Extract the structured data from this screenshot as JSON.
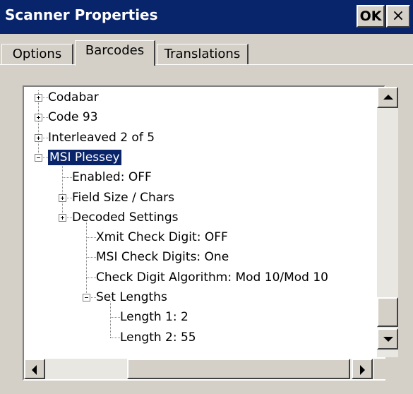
{
  "window": {
    "title": "Scanner Properties",
    "ok_label": "OK",
    "close_label": "×"
  },
  "tabs": [
    {
      "label": "Options"
    },
    {
      "label": "Barcodes"
    },
    {
      "label": "Translations"
    }
  ],
  "tree": {
    "nodes": [
      {
        "label": "Codabar",
        "level": 0,
        "expander": "plus"
      },
      {
        "label": "Code 93",
        "level": 0,
        "expander": "plus"
      },
      {
        "label": "Interleaved 2 of 5",
        "level": 0,
        "expander": "plus"
      },
      {
        "label": "MSI Plessey",
        "level": 0,
        "expander": "minus",
        "selected": true
      },
      {
        "label": "Enabled: OFF",
        "level": 1,
        "expander": "none"
      },
      {
        "label": "Field Size / Chars",
        "level": 1,
        "expander": "plus"
      },
      {
        "label": "Decoded Settings",
        "level": 1,
        "expander": "plus"
      },
      {
        "label": "Xmit Check Digit: OFF",
        "level": 2,
        "expander": "none"
      },
      {
        "label": "MSI Check Digits: One",
        "level": 2,
        "expander": "none"
      },
      {
        "label": "Check Digit Algorithm: Mod 10/Mod 10",
        "level": 2,
        "expander": "none"
      },
      {
        "label": "Set Lengths",
        "level": 2,
        "expander": "minus"
      },
      {
        "label": "Length 1: 2",
        "level": 3,
        "expander": "none"
      },
      {
        "label": "Length 2: 55",
        "level": 3,
        "expander": "none"
      }
    ]
  }
}
